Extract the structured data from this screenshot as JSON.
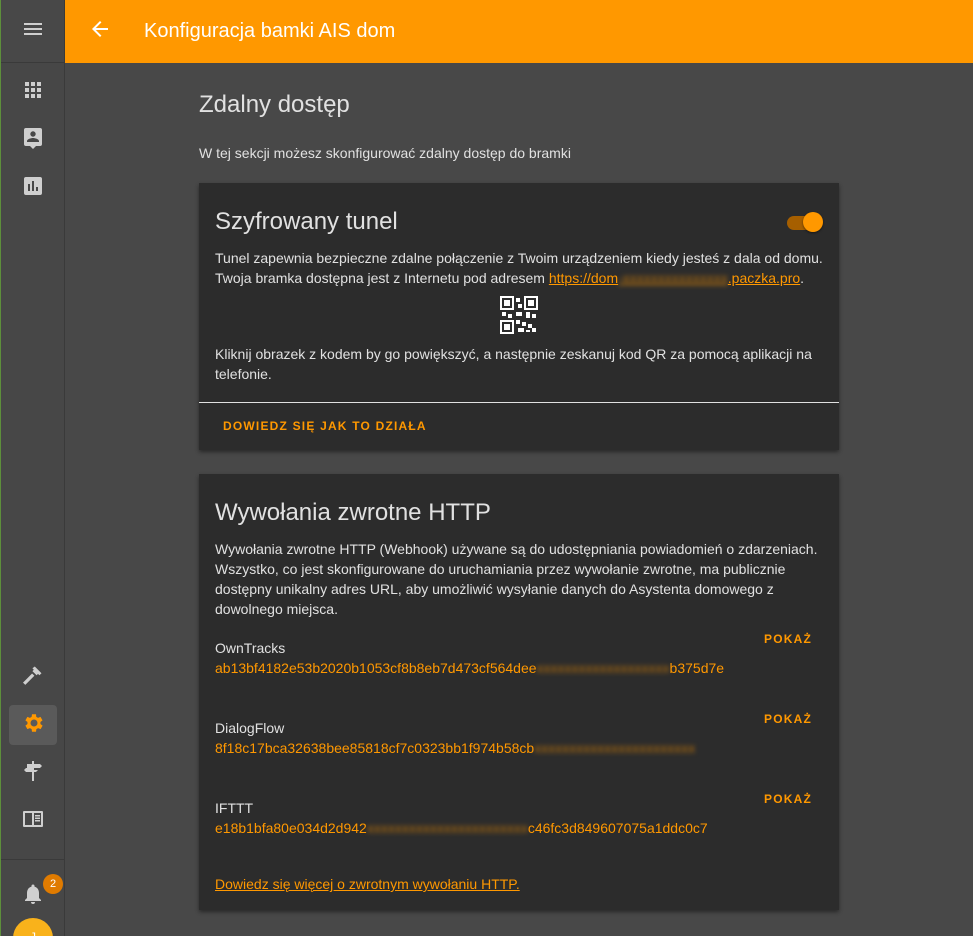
{
  "header": {
    "title": "Konfiguracja bamki AIS dom"
  },
  "sidebar": {
    "notification_count": "2",
    "avatar_initial": "J"
  },
  "page": {
    "title": "Zdalny dostęp",
    "description": "W tej sekcji możesz skonfigurować zdalny dostęp do bramki"
  },
  "tunnel": {
    "title": "Szyfrowany tunel",
    "enabled": true,
    "text_line1": "Tunel zapewnia bezpieczne zdalne połączenie z Twoim urządzeniem kiedy jesteś z dala od domu.",
    "text_line2_prefix": "Twoja bramka dostępna jest z Internetu pod adresem ",
    "url_start": "https://dom",
    "url_hidden": "-xxxxxxxxxxxxxxx",
    "url_end": ".paczka.pro",
    "text_line2_suffix": ".",
    "qr_hint": "Kliknij obrazek z kodem by go powiększyć, a następnie zeskanuj kod QR za pomocą aplikacji na telefonie.",
    "learn_button": "DOWIEDZ SIĘ JAK TO DZIAŁA"
  },
  "webhooks": {
    "title": "Wywołania zwrotne HTTP",
    "description": "Wywołania zwrotne HTTP (Webhook) używane są do udostępniania powiadomień o zdarzeniach. Wszystko, co jest skonfigurowane do uruchamiania przez wywołanie zwrotne, ma publicznie dostępny unikalny adres URL, aby umożliwić wysyłanie danych do Asystenta domowego z dowolnego miejsca.",
    "show_label": "POKAŻ",
    "items": [
      {
        "name": "OwnTracks",
        "id_visible": "ab13bf4182e53b2020b1053cf8b8eb7d473cf564dee",
        "id_hidden": "xxxxxxxxxxxxxxxxxxx",
        "id_end": "b375d7e"
      },
      {
        "name": "DialogFlow",
        "id_visible": "8f18c17bca32638bee85818cf7c0323bb1f974b58cb",
        "id_hidden": "xxxxxxxxxxxxxxxxxxxxxxx",
        "id_end": ""
      },
      {
        "name": "IFTTT",
        "id_visible": "e18b1bfa80e034d2d942",
        "id_hidden": "xxxxxxxxxxxxxxxxxxxxxxx",
        "id_end": "c46fc3d849607075a1ddc0c7"
      }
    ],
    "learn_more_link": "Dowiedz się więcej o zwrotnym wywołaniu HTTP."
  },
  "colors": {
    "accent": "#ff9800",
    "card": "#2c2c2c",
    "background": "#484848"
  }
}
